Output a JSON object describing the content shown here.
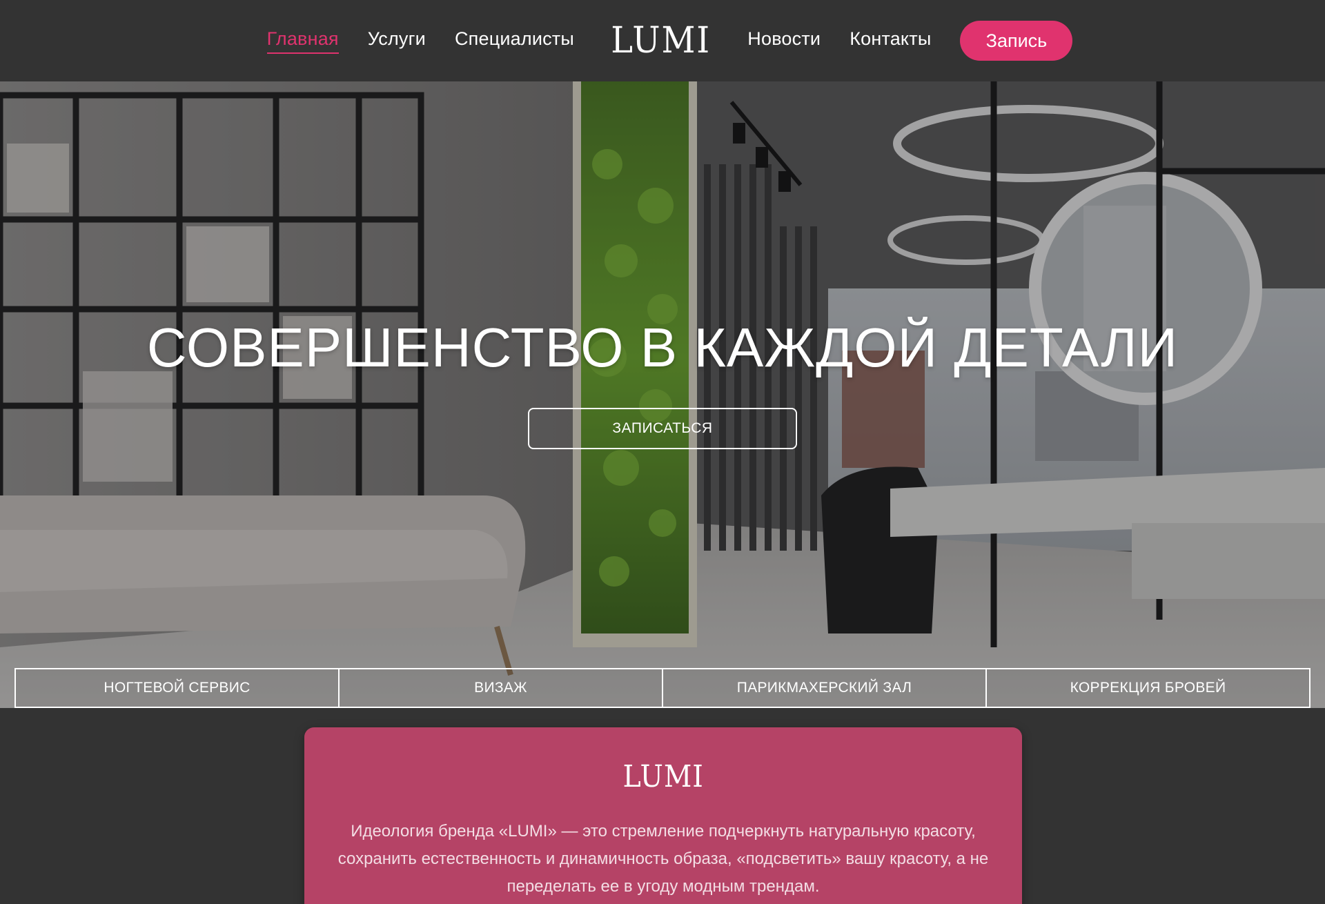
{
  "nav": {
    "left": [
      {
        "label": "Главная",
        "active": true
      },
      {
        "label": "Услуги",
        "active": false
      },
      {
        "label": "Специалисты",
        "active": false
      }
    ],
    "logo": "LUMI",
    "right": [
      {
        "label": "Новости",
        "active": false
      },
      {
        "label": "Контакты",
        "active": false
      }
    ],
    "cta_label": "Запись"
  },
  "hero": {
    "title": "СОВЕРШЕНСТВО В КАЖДОЙ ДЕТАЛИ",
    "button_label": "ЗАПИСАТЬСЯ",
    "services": [
      "НОГТЕВОЙ СЕРВИС",
      "ВИЗАЖ",
      "ПАРИКМАХЕРСКИЙ ЗАЛ",
      "КОРРЕКЦИЯ БРОВЕЙ"
    ]
  },
  "about": {
    "logo": "LUMI",
    "text": "Идеология бренда «LUMI» — это стремление подчеркнуть натуральную красоту, сохранить естественность и динамичность образа, «подсветить» вашу красоту, а не переделать ее в угоду модным трендам."
  },
  "colors": {
    "background": "#333333",
    "accent": "#e0336e",
    "card": "#b54366"
  }
}
